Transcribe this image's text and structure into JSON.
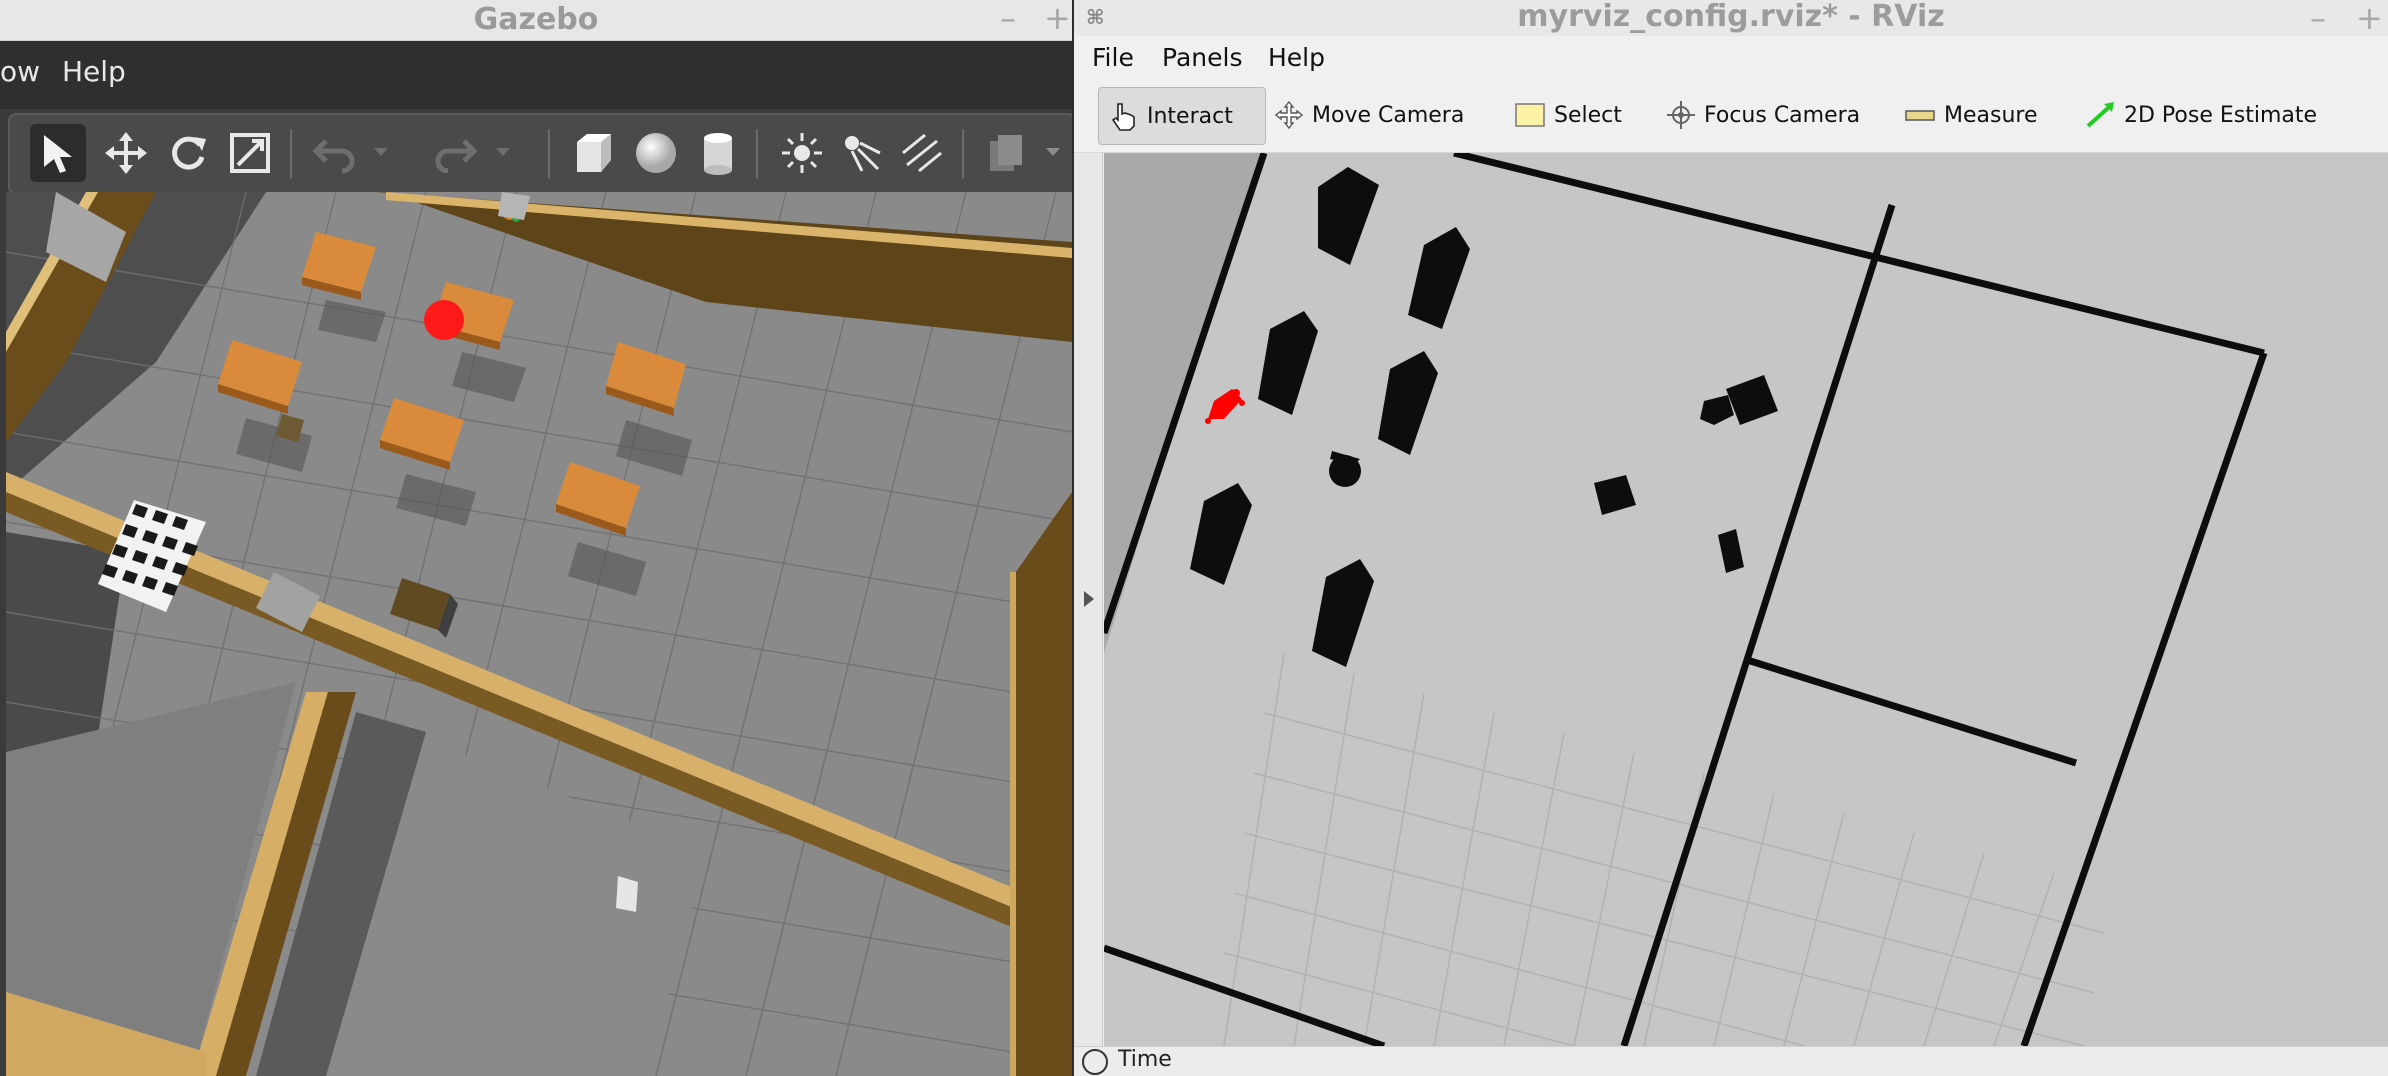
{
  "gazebo": {
    "title": "Gazebo",
    "window_buttons": {
      "minimize": "–",
      "maximize": "+"
    },
    "menu": {
      "partial_item": "ow",
      "help": "Help"
    },
    "toolbar_icons": [
      "select-arrow-icon",
      "translate-icon",
      "rotate-icon",
      "scale-icon",
      "undo-icon",
      "undo-dropdown-icon",
      "redo-icon",
      "redo-dropdown-icon",
      "box-icon",
      "sphere-icon",
      "cylinder-icon",
      "point-light-icon",
      "spot-light-icon",
      "directional-light-icon",
      "copy-icon",
      "more-icon"
    ]
  },
  "rviz": {
    "title": "myrviz_config.rviz* - RViz",
    "window_buttons": {
      "minimize": "–",
      "maximize": "+"
    },
    "menu": {
      "file": "File",
      "panels": "Panels",
      "help": "Help"
    },
    "tools": {
      "interact": "Interact",
      "move_camera": "Move Camera",
      "select": "Select",
      "focus_camera": "Focus Camera",
      "measure": "Measure",
      "pose_estimate": "2D Pose Estimate"
    },
    "bottom_panel": {
      "label": "Time"
    }
  },
  "colors": {
    "gazebo_floor": "#8c8c8c",
    "wall_wood": "#c9a057",
    "table_orange": "#d98a3a",
    "robot_red": "#ff1a1a",
    "map_free": "#c6c6c6",
    "map_unknown": "#a9a9a9",
    "map_occupied": "#0d0d0d",
    "laser_red": "#ff0000",
    "pose_green": "#22cc22"
  }
}
